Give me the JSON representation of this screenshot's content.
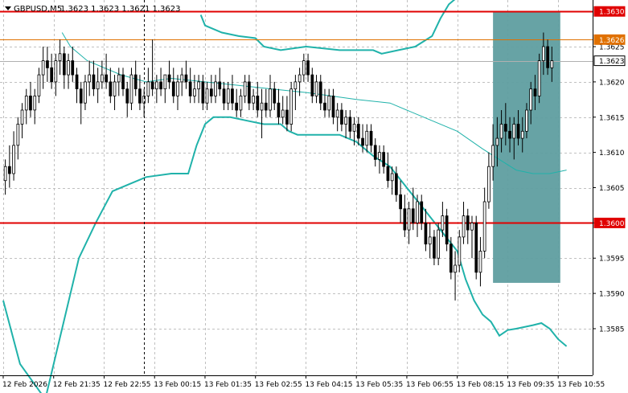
{
  "header": {
    "symbol_tf": "GBPUSD,M5",
    "ohlc": "1.3623 1.3623 1.3621 1.3623"
  },
  "chart_data": {
    "type": "candlestick",
    "ylim": [
      1.35785,
      1.36315
    ],
    "x_range": [
      0,
      140
    ],
    "grid": true,
    "y_ticks": [
      {
        "value": 1.3625,
        "label": "1.3625"
      },
      {
        "value": 1.362,
        "label": "1.3620"
      },
      {
        "value": 1.3615,
        "label": "1.3615"
      },
      {
        "value": 1.361,
        "label": "1.3610"
      },
      {
        "value": 1.3605,
        "label": "1.3605"
      },
      {
        "value": 1.36,
        "label": "1.3600"
      },
      {
        "value": 1.3595,
        "label": "1.3595"
      },
      {
        "value": 1.359,
        "label": "1.3590"
      },
      {
        "value": 1.3585,
        "label": "1.3585"
      }
    ],
    "x_ticks": [
      {
        "x": 0,
        "label": "12 Feb 2026"
      },
      {
        "x": 12,
        "label": "12 Feb 21:35"
      },
      {
        "x": 24,
        "label": "12 Feb 22:55"
      },
      {
        "x": 36,
        "label": "13 Feb 00:15"
      },
      {
        "x": 48,
        "label": "13 Feb 01:35"
      },
      {
        "x": 60,
        "label": "13 Feb 02:55"
      },
      {
        "x": 72,
        "label": "13 Feb 04:15"
      },
      {
        "x": 84,
        "label": "13 Feb 05:35"
      },
      {
        "x": 96,
        "label": "13 Feb 06:55"
      },
      {
        "x": 108,
        "label": "13 Feb 08:15"
      },
      {
        "x": 120,
        "label": "13 Feb 09:35"
      },
      {
        "x": 132,
        "label": "13 Feb 10:55"
      }
    ],
    "levels": [
      {
        "name": "resistance-line",
        "value": 1.363,
        "label": "1.3630",
        "color": "#e00000",
        "style": "solid",
        "width": 2
      },
      {
        "name": "orange-level",
        "value": 1.3626,
        "label": "1.3626",
        "color": "#e07000",
        "style": "solid",
        "width": 1
      },
      {
        "name": "current-price",
        "value": 1.3623,
        "label": "1.3623",
        "color": "#b0b0b0",
        "style": "solid",
        "width": 1
      },
      {
        "name": "support-line",
        "value": 1.36,
        "label": "1.3600",
        "color": "#e00000",
        "style": "solid",
        "width": 2
      }
    ],
    "highlight": {
      "x_from": 116.5,
      "x_to": 132.5,
      "y_from": 1.35915,
      "y_to": 1.363,
      "color": "#5f9ea0"
    },
    "separator_x": 33.5,
    "upper_band": [
      [
        47,
        1.36295
      ],
      [
        48,
        1.3628
      ],
      [
        52,
        1.3627
      ],
      [
        56,
        1.36265
      ],
      [
        60,
        1.36262
      ],
      [
        62,
        1.3625
      ],
      [
        66,
        1.36245
      ],
      [
        72,
        1.3625
      ],
      [
        80,
        1.36245
      ],
      [
        88,
        1.36245
      ],
      [
        90,
        1.3624
      ],
      [
        94,
        1.36245
      ],
      [
        98,
        1.3625
      ],
      [
        102,
        1.36265
      ],
      [
        104,
        1.3629
      ],
      [
        106,
        1.3631
      ],
      [
        108,
        1.3632
      ]
    ],
    "lower_band": [
      [
        0,
        1.3589
      ],
      [
        4,
        1.358
      ],
      [
        10,
        1.3575
      ],
      [
        14,
        1.3585
      ],
      [
        18,
        1.3595
      ],
      [
        22,
        1.36
      ],
      [
        26,
        1.36045
      ],
      [
        30,
        1.36055
      ],
      [
        34,
        1.36065
      ],
      [
        40,
        1.3607
      ],
      [
        44,
        1.3607
      ],
      [
        46,
        1.3611
      ],
      [
        48,
        1.3614
      ],
      [
        50,
        1.3615
      ],
      [
        54,
        1.3615
      ],
      [
        58,
        1.36145
      ],
      [
        62,
        1.3614
      ],
      [
        66,
        1.3614
      ],
      [
        68,
        1.3613
      ],
      [
        70,
        1.36125
      ],
      [
        74,
        1.36125
      ],
      [
        80,
        1.36125
      ],
      [
        84,
        1.36115
      ],
      [
        88,
        1.36095
      ],
      [
        92,
        1.3608
      ],
      [
        96,
        1.3605
      ],
      [
        100,
        1.3602
      ],
      [
        104,
        1.3599
      ],
      [
        108,
        1.3596
      ],
      [
        110,
        1.3592
      ],
      [
        112,
        1.3589
      ],
      [
        114,
        1.3587
      ],
      [
        116,
        1.3586
      ],
      [
        118,
        1.3584
      ],
      [
        120,
        1.35848
      ],
      [
        122,
        1.3585
      ],
      [
        126,
        1.35855
      ],
      [
        128,
        1.35858
      ],
      [
        130,
        1.3585
      ],
      [
        132,
        1.35835
      ],
      [
        134,
        1.35825
      ]
    ],
    "middle_ma": [
      [
        14,
        1.3627
      ],
      [
        16,
        1.3625
      ],
      [
        18,
        1.3624
      ],
      [
        20,
        1.3623
      ],
      [
        24,
        1.3622
      ],
      [
        28,
        1.3621
      ],
      [
        34,
        1.362
      ],
      [
        40,
        1.36205
      ],
      [
        48,
        1.362
      ],
      [
        56,
        1.36195
      ],
      [
        64,
        1.3619
      ],
      [
        72,
        1.36185
      ],
      [
        78,
        1.3618
      ],
      [
        84,
        1.36175
      ],
      [
        92,
        1.3617
      ],
      [
        100,
        1.3615
      ],
      [
        108,
        1.3613
      ],
      [
        114,
        1.36105
      ],
      [
        118,
        1.3609
      ],
      [
        122,
        1.36075
      ],
      [
        126,
        1.3607
      ],
      [
        130,
        1.3607
      ],
      [
        134,
        1.36075
      ]
    ],
    "candles": [
      [
        1.3606,
        1.3609,
        1.3604,
        1.3608
      ],
      [
        1.3608,
        1.3611,
        1.3605,
        1.3607
      ],
      [
        1.3607,
        1.3613,
        1.3606,
        1.3611
      ],
      [
        1.3611,
        1.3615,
        1.3609,
        1.3614
      ],
      [
        1.3614,
        1.3617,
        1.3612,
        1.3616
      ],
      [
        1.3616,
        1.3619,
        1.3614,
        1.3618
      ],
      [
        1.3618,
        1.362,
        1.3615,
        1.3616
      ],
      [
        1.3616,
        1.3619,
        1.3614,
        1.3618
      ],
      [
        1.3618,
        1.3622,
        1.3617,
        1.3621
      ],
      [
        1.3621,
        1.3625,
        1.3619,
        1.3623
      ],
      [
        1.3623,
        1.3625,
        1.362,
        1.3622
      ],
      [
        1.3622,
        1.3624,
        1.3619,
        1.362
      ],
      [
        1.362,
        1.3624,
        1.3618,
        1.3623
      ],
      [
        1.3623,
        1.3626,
        1.3621,
        1.3624
      ],
      [
        1.3624,
        1.3625,
        1.3619,
        1.3621
      ],
      [
        1.3621,
        1.3624,
        1.3619,
        1.3623
      ],
      [
        1.3623,
        1.3625,
        1.362,
        1.3621
      ],
      [
        1.3621,
        1.3622,
        1.3617,
        1.3619
      ],
      [
        1.3619,
        1.362,
        1.3614,
        1.3617
      ],
      [
        1.3617,
        1.3621,
        1.3616,
        1.362
      ],
      [
        1.362,
        1.3623,
        1.3618,
        1.3621
      ],
      [
        1.3621,
        1.3623,
        1.3618,
        1.3619
      ],
      [
        1.3619,
        1.3622,
        1.3617,
        1.362
      ],
      [
        1.362,
        1.3623,
        1.3619,
        1.3621
      ],
      [
        1.3621,
        1.3624,
        1.3619,
        1.362
      ],
      [
        1.362,
        1.3622,
        1.3617,
        1.3618
      ],
      [
        1.3618,
        1.3621,
        1.3616,
        1.362
      ],
      [
        1.362,
        1.3622,
        1.3618,
        1.3621
      ],
      [
        1.3621,
        1.3622,
        1.3618,
        1.3619
      ],
      [
        1.3619,
        1.362,
        1.3615,
        1.3617
      ],
      [
        1.3617,
        1.3622,
        1.3616,
        1.3621
      ],
      [
        1.3621,
        1.3623,
        1.3618,
        1.3619
      ],
      [
        1.3619,
        1.3621,
        1.3616,
        1.3617
      ],
      [
        1.3617,
        1.3619,
        1.3615,
        1.3618
      ],
      [
        1.3618,
        1.3622,
        1.3617,
        1.362
      ],
      [
        1.362,
        1.3626,
        1.3618,
        1.3619
      ],
      [
        1.3619,
        1.3621,
        1.3617,
        1.362
      ],
      [
        1.362,
        1.3622,
        1.3618,
        1.3619
      ],
      [
        1.3619,
        1.3621,
        1.3617,
        1.3621
      ],
      [
        1.3621,
        1.3623,
        1.3619,
        1.362
      ],
      [
        1.362,
        1.3622,
        1.3617,
        1.3618
      ],
      [
        1.3618,
        1.3621,
        1.3616,
        1.362
      ],
      [
        1.362,
        1.3622,
        1.3618,
        1.3621
      ],
      [
        1.3621,
        1.3623,
        1.3619,
        1.362
      ],
      [
        1.362,
        1.3622,
        1.3617,
        1.3618
      ],
      [
        1.3618,
        1.3621,
        1.3617,
        1.3619
      ],
      [
        1.3619,
        1.3621,
        1.3617,
        1.362
      ],
      [
        1.362,
        1.3621,
        1.3616,
        1.3617
      ],
      [
        1.3617,
        1.362,
        1.3616,
        1.3619
      ],
      [
        1.3619,
        1.3621,
        1.3617,
        1.3618
      ],
      [
        1.3618,
        1.3621,
        1.3617,
        1.362
      ],
      [
        1.362,
        1.3622,
        1.3618,
        1.3619
      ],
      [
        1.3619,
        1.362,
        1.3616,
        1.3617
      ],
      [
        1.3617,
        1.362,
        1.3616,
        1.3619
      ],
      [
        1.3619,
        1.3621,
        1.3616,
        1.3617
      ],
      [
        1.3617,
        1.3619,
        1.3615,
        1.3616
      ],
      [
        1.3616,
        1.3619,
        1.3615,
        1.3618
      ],
      [
        1.3618,
        1.3621,
        1.3617,
        1.362
      ],
      [
        1.362,
        1.3621,
        1.3616,
        1.3617
      ],
      [
        1.3617,
        1.3619,
        1.3616,
        1.3618
      ],
      [
        1.3618,
        1.362,
        1.3615,
        1.3616
      ],
      [
        1.3616,
        1.3619,
        1.3612,
        1.3617
      ],
      [
        1.3617,
        1.3619,
        1.3615,
        1.3616
      ],
      [
        1.3616,
        1.3621,
        1.3615,
        1.3619
      ],
      [
        1.3619,
        1.362,
        1.3616,
        1.3617
      ],
      [
        1.3617,
        1.3619,
        1.3614,
        1.3615
      ],
      [
        1.3615,
        1.3618,
        1.3614,
        1.3616
      ],
      [
        1.3616,
        1.3618,
        1.3613,
        1.3614
      ],
      [
        1.3614,
        1.362,
        1.3613,
        1.3619
      ],
      [
        1.3619,
        1.3621,
        1.3616,
        1.362
      ],
      [
        1.362,
        1.3622,
        1.3618,
        1.3621
      ],
      [
        1.3621,
        1.3624,
        1.362,
        1.3623
      ],
      [
        1.3623,
        1.3624,
        1.362,
        1.3621
      ],
      [
        1.3621,
        1.3622,
        1.3617,
        1.3618
      ],
      [
        1.3618,
        1.3621,
        1.3617,
        1.362
      ],
      [
        1.362,
        1.3621,
        1.3616,
        1.3617
      ],
      [
        1.3617,
        1.3619,
        1.3615,
        1.3616
      ],
      [
        1.3616,
        1.3619,
        1.3615,
        1.3618
      ],
      [
        1.3618,
        1.3619,
        1.3614,
        1.3615
      ],
      [
        1.3615,
        1.3617,
        1.3613,
        1.3616
      ],
      [
        1.3616,
        1.3617,
        1.3613,
        1.3614
      ],
      [
        1.3614,
        1.3616,
        1.3612,
        1.3615
      ],
      [
        1.3615,
        1.3616,
        1.3612,
        1.3613
      ],
      [
        1.3613,
        1.3615,
        1.3611,
        1.3614
      ],
      [
        1.3614,
        1.3615,
        1.3611,
        1.3612
      ],
      [
        1.3612,
        1.3614,
        1.361,
        1.3611
      ],
      [
        1.3611,
        1.3614,
        1.361,
        1.3613
      ],
      [
        1.3613,
        1.3614,
        1.361,
        1.3611
      ],
      [
        1.3611,
        1.3612,
        1.3608,
        1.3609
      ],
      [
        1.3609,
        1.3611,
        1.3607,
        1.361
      ],
      [
        1.361,
        1.3611,
        1.3607,
        1.3608
      ],
      [
        1.3608,
        1.361,
        1.3605,
        1.3606
      ],
      [
        1.3606,
        1.3608,
        1.3604,
        1.3607
      ],
      [
        1.3607,
        1.3608,
        1.3603,
        1.3604
      ],
      [
        1.3604,
        1.3606,
        1.36,
        1.3602
      ],
      [
        1.3602,
        1.3604,
        1.3598,
        1.3599
      ],
      [
        1.3599,
        1.3603,
        1.3597,
        1.3602
      ],
      [
        1.3602,
        1.3605,
        1.3599,
        1.36
      ],
      [
        1.36,
        1.3604,
        1.3598,
        1.3603
      ],
      [
        1.3603,
        1.3604,
        1.3599,
        1.36
      ],
      [
        1.36,
        1.3602,
        1.3596,
        1.3597
      ],
      [
        1.3597,
        1.36,
        1.3595,
        1.3598
      ],
      [
        1.3598,
        1.3599,
        1.3594,
        1.3595
      ],
      [
        1.3595,
        1.36,
        1.3594,
        1.3599
      ],
      [
        1.3599,
        1.3603,
        1.3598,
        1.3601
      ],
      [
        1.3601,
        1.3602,
        1.3596,
        1.3597
      ],
      [
        1.3597,
        1.3598,
        1.3592,
        1.3593
      ],
      [
        1.3593,
        1.3596,
        1.3589,
        1.3594
      ],
      [
        1.3594,
        1.3599,
        1.3593,
        1.3598
      ],
      [
        1.3598,
        1.3603,
        1.3597,
        1.3601
      ],
      [
        1.3601,
        1.3602,
        1.3597,
        1.3599
      ],
      [
        1.3599,
        1.3601,
        1.3595,
        1.36
      ],
      [
        1.36,
        1.3601,
        1.3592,
        1.3593
      ],
      [
        1.3593,
        1.3598,
        1.3591,
        1.3596
      ],
      [
        1.3596,
        1.3605,
        1.3595,
        1.3603
      ],
      [
        1.3603,
        1.361,
        1.3602,
        1.3608
      ],
      [
        1.3608,
        1.3614,
        1.3606,
        1.3611
      ],
      [
        1.3611,
        1.3615,
        1.3608,
        1.3612
      ],
      [
        1.3612,
        1.3616,
        1.361,
        1.3614
      ],
      [
        1.3614,
        1.3617,
        1.3611,
        1.3613
      ],
      [
        1.3613,
        1.3615,
        1.361,
        1.3612
      ],
      [
        1.3612,
        1.3615,
        1.3609,
        1.3614
      ],
      [
        1.3614,
        1.3616,
        1.3611,
        1.3612
      ],
      [
        1.3612,
        1.3615,
        1.361,
        1.3613
      ],
      [
        1.3613,
        1.3617,
        1.3612,
        1.3616
      ],
      [
        1.3616,
        1.362,
        1.3614,
        1.3619
      ],
      [
        1.3619,
        1.3621,
        1.3616,
        1.3618
      ],
      [
        1.3618,
        1.3624,
        1.3617,
        1.3623
      ],
      [
        1.3623,
        1.3627,
        1.3621,
        1.3625
      ],
      [
        1.3625,
        1.3626,
        1.3621,
        1.3622
      ],
      [
        1.3622,
        1.3625,
        1.362,
        1.3623
      ]
    ]
  }
}
